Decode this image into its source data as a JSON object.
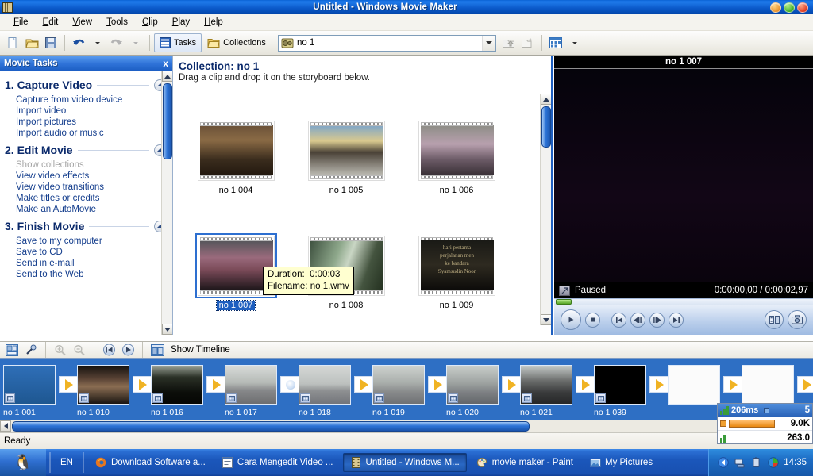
{
  "window": {
    "title": "Untitled - Windows Movie Maker",
    "app_icon": "filmstrip-icon",
    "minimize_label": "Minimize",
    "maximize_label": "Maximize",
    "close_label": "Close"
  },
  "menubar": {
    "items": [
      {
        "label": "File",
        "accel": "F"
      },
      {
        "label": "Edit",
        "accel": "E"
      },
      {
        "label": "View",
        "accel": "V"
      },
      {
        "label": "Tools",
        "accel": "T"
      },
      {
        "label": "Clip",
        "accel": "C"
      },
      {
        "label": "Play",
        "accel": "P"
      },
      {
        "label": "Help",
        "accel": "H"
      }
    ]
  },
  "toolbar": {
    "new_label": "New Project",
    "open_label": "Open Project",
    "save_label": "Save Project",
    "undo_label": "Undo",
    "redo_label": "Redo",
    "tasks_label": "Tasks",
    "collections_label": "Collections",
    "collection_value": "no 1",
    "collection_placeholder": "no 1",
    "views_label": "Views"
  },
  "tasks_pane": {
    "header": "Movie Tasks",
    "close_label": "x",
    "groups": [
      {
        "title": "1. Capture Video",
        "links": [
          {
            "label": "Capture from video device",
            "disabled": false
          },
          {
            "label": "Import video",
            "disabled": false
          },
          {
            "label": "Import pictures",
            "disabled": false
          },
          {
            "label": "Import audio or music",
            "disabled": false
          }
        ]
      },
      {
        "title": "2. Edit Movie",
        "links": [
          {
            "label": "Show collections",
            "disabled": true
          },
          {
            "label": "View video effects",
            "disabled": false
          },
          {
            "label": "View video transitions",
            "disabled": false
          },
          {
            "label": "Make titles or credits",
            "disabled": false
          },
          {
            "label": "Make an AutoMovie",
            "disabled": false
          }
        ]
      },
      {
        "title": "3. Finish Movie",
        "links": [
          {
            "label": "Save to my computer",
            "disabled": false
          },
          {
            "label": "Save to CD",
            "disabled": false
          },
          {
            "label": "Send in e-mail",
            "disabled": false
          },
          {
            "label": "Send to the Web",
            "disabled": false
          }
        ]
      }
    ]
  },
  "collection": {
    "title": "Collection: no 1",
    "subtitle": "Drag a clip and drop it on the storyboard below.",
    "clips": [
      {
        "name": "no 1 004",
        "selected": false,
        "thumb": "crowd-indoor"
      },
      {
        "name": "no 1 005",
        "selected": false,
        "thumb": "crowd-street"
      },
      {
        "name": "no 1 006",
        "selected": false,
        "thumb": "group-wall"
      },
      {
        "name": "no 1 007",
        "selected": true,
        "thumb": "group-seated"
      },
      {
        "name": "no 1 008",
        "selected": false,
        "thumb": "waterfall"
      },
      {
        "name": "no 1 009",
        "selected": false,
        "thumb": "title-text"
      }
    ],
    "tooltip": {
      "duration_label": "Duration:",
      "duration_value": "0:00:03",
      "filename_label": "Filename:",
      "filename_value": "no 1.wmv"
    }
  },
  "preview": {
    "title": "no 1 007",
    "status": "Paused",
    "timecode": "0:00:00,00 / 0:00:02,97",
    "buttons": {
      "play": "play-button",
      "stop": "stop-button",
      "prev": "previous-frame-button",
      "back": "step-back-button",
      "forward": "step-forward-button",
      "next": "next-frame-button",
      "split": "split-clip-button",
      "snapshot": "take-picture-button",
      "fullscreen": "fullscreen-button"
    }
  },
  "storyboard_toolbar": {
    "storyboard_view_label": "Storyboard View",
    "narrate_label": "Narrate Timeline",
    "zoom_in_label": "Zoom In",
    "zoom_out_label": "Zoom Out",
    "rewind_label": "Rewind Timeline",
    "play_label": "Play Timeline",
    "show_timeline_label": "Show Timeline"
  },
  "storyboard": {
    "clips": [
      {
        "name": "no 1 001",
        "thumb": "blue-frame"
      },
      {
        "name": "no 1 010",
        "thumb": "two-people"
      },
      {
        "name": "no 1 016",
        "thumb": "dark-road"
      },
      {
        "name": "no 1 017",
        "thumb": "foggy-road"
      },
      {
        "name": "no 1 018",
        "thumb": "highway"
      },
      {
        "name": "no 1 019",
        "thumb": "highway-trees"
      },
      {
        "name": "no 1 020",
        "thumb": "highway-barrier"
      },
      {
        "name": "no 1 021",
        "thumb": "truck-road"
      },
      {
        "name": "no 1 039",
        "thumb": "black-frame"
      },
      {
        "name": "",
        "thumb": "empty"
      },
      {
        "name": "",
        "thumb": "empty"
      }
    ]
  },
  "statusbar": {
    "text": "Ready"
  },
  "perf_overlay": {
    "latency": "206ms",
    "count": "5",
    "memory": "9.0K",
    "rate": "263.0"
  },
  "taskbar": {
    "start_label": "Start",
    "language": "EN",
    "items": [
      {
        "label": "Download Software a...",
        "icon": "firefox-icon",
        "active": false
      },
      {
        "label": "Cara Mengedit Video ...",
        "icon": "word-icon",
        "active": false
      },
      {
        "label": "Untitled - Windows M...",
        "icon": "filmstrip-icon",
        "active": true
      },
      {
        "label": "movie maker - Paint",
        "icon": "paint-icon",
        "active": false
      },
      {
        "label": "My Pictures",
        "icon": "folder-icon",
        "active": false
      }
    ],
    "tray": [
      {
        "name": "back-arrow-icon"
      },
      {
        "name": "network-icon"
      },
      {
        "name": "battery-icon"
      },
      {
        "name": "display-icon"
      }
    ],
    "clock": "14:35"
  },
  "colors": {
    "title_blue": "#0a58c8",
    "accent_blue": "#1e5fc0",
    "storyboard_bg": "#2e6fc4",
    "tooltip_bg": "#ffffd0",
    "heading_navy": "#0b2a6b"
  }
}
